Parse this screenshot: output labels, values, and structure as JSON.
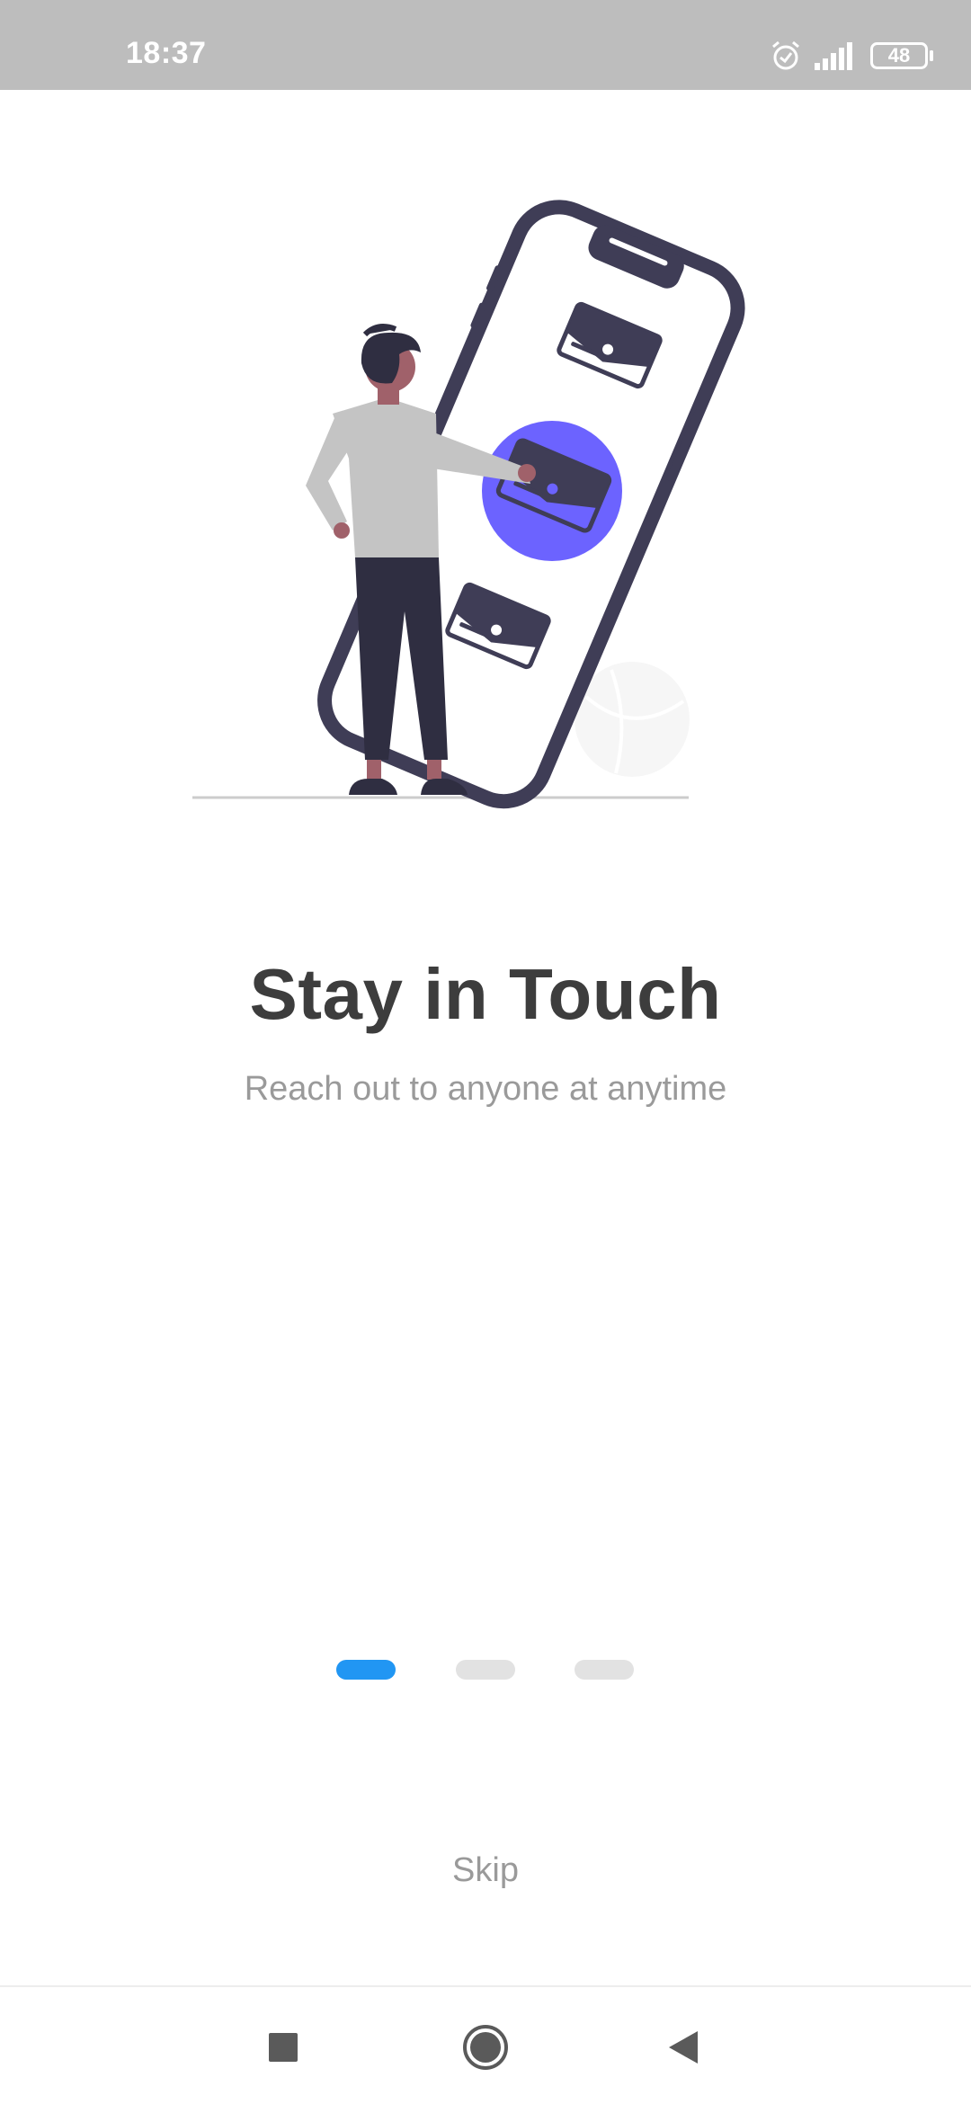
{
  "status_bar": {
    "time": "18:37",
    "battery_level": "48",
    "icons": [
      "alarm-icon",
      "signal-icon",
      "battery-icon"
    ]
  },
  "onboarding": {
    "title": "Stay in Touch",
    "subtitle": "Reach out to anyone at anytime",
    "page_indicator": {
      "total": 3,
      "active": 1
    },
    "skip_label": "Skip"
  },
  "nav_bar": {
    "buttons": [
      "recents-square-icon",
      "home-circle-icon",
      "back-triangle-icon"
    ]
  },
  "colors": {
    "accent": "#6c63ff",
    "indicator_active": "#2196f3",
    "indicator_inactive": "#e2e2e2",
    "title": "#3d3d3d",
    "subtitle": "#9a9a9a",
    "status_bar": "#bdbdbd",
    "illustration_dark": "#3f3d56"
  }
}
